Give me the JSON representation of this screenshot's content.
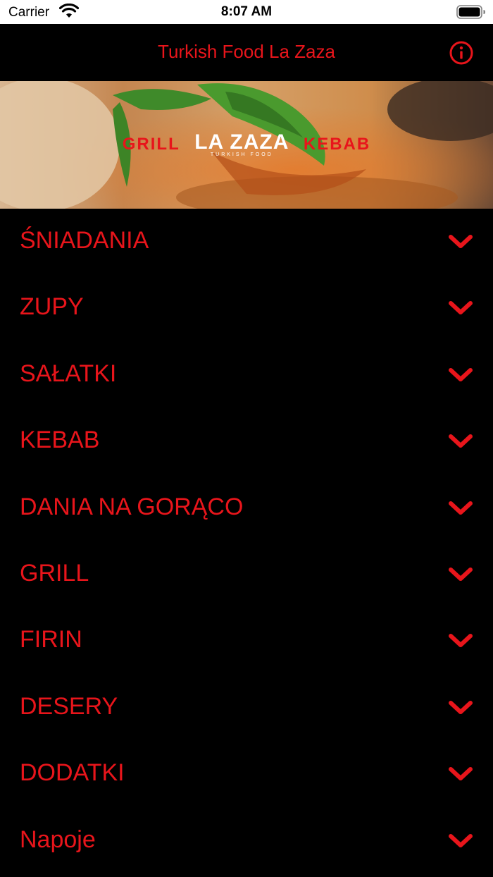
{
  "status_bar": {
    "carrier": "Carrier",
    "time": "8:07 AM"
  },
  "nav": {
    "title": "Turkish Food La Zaza",
    "info_icon": "info-circle-icon"
  },
  "banner": {
    "left_text": "GRILL",
    "brand_name": "LA ZAZA",
    "brand_subtitle": "TURKISH FOOD",
    "right_text": "KEBAB"
  },
  "menu": {
    "items": [
      {
        "label": "ŚNIADANIA"
      },
      {
        "label": "ZUPY"
      },
      {
        "label": "SAŁATKI"
      },
      {
        "label": "KEBAB"
      },
      {
        "label": "DANIA NA GORĄCO"
      },
      {
        "label": "GRILL"
      },
      {
        "label": "FIRIN"
      },
      {
        "label": "DESERY"
      },
      {
        "label": "DODATKI"
      },
      {
        "label": "Napoje"
      }
    ],
    "expand_icon": "chevron-down-icon"
  },
  "colors": {
    "accent": "#e8151b",
    "background": "#000000",
    "status_bar": "#ffffff"
  }
}
